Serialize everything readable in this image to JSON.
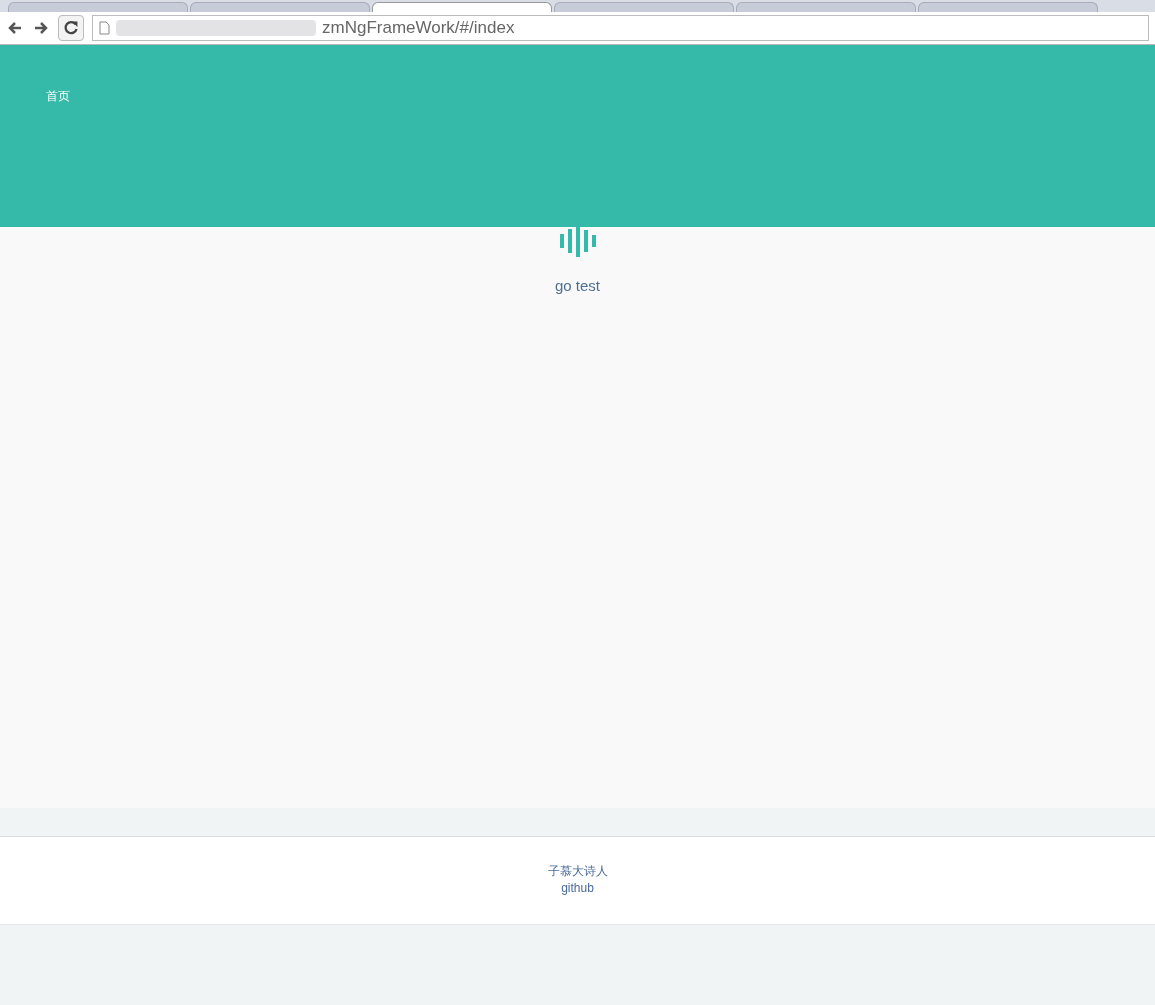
{
  "browser": {
    "tabs": [
      {
        "selected": false
      },
      {
        "selected": false
      },
      {
        "selected": true
      },
      {
        "selected": false
      },
      {
        "selected": false
      },
      {
        "selected": false
      }
    ],
    "address": "zmNgFrameWork/#/index"
  },
  "header": {
    "nav": [
      "首页"
    ]
  },
  "content": {
    "link": "go test"
  },
  "footer": {
    "lines": [
      "子慕大诗人",
      "github"
    ]
  }
}
